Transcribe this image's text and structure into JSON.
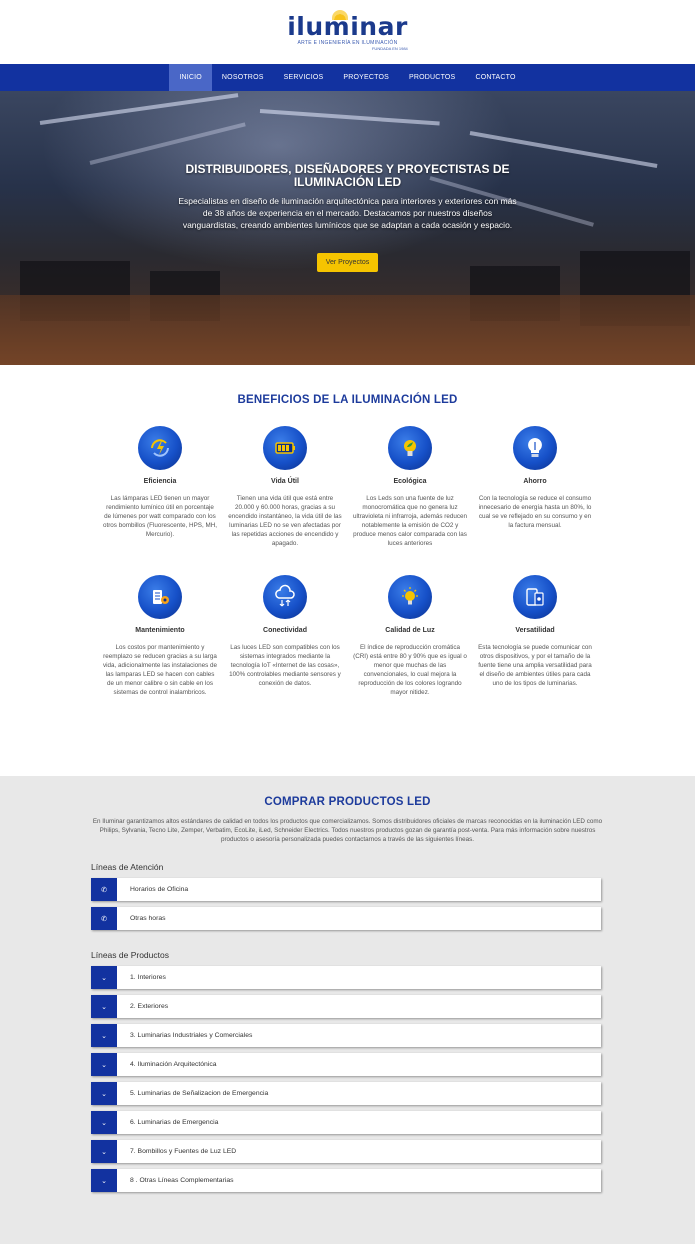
{
  "brand": {
    "logo_text": "iluminar",
    "tagline": "ARTE E INGENIERÍA EN ILUMINACIÓN",
    "founded": "FUNDADA EN 1984"
  },
  "nav": {
    "items": [
      {
        "label": "INICIO"
      },
      {
        "label": "NOSOTROS"
      },
      {
        "label": "SERVICIOS"
      },
      {
        "label": "PROYECTOS"
      },
      {
        "label": "PRODUCTOS"
      },
      {
        "label": "CONTACTO"
      }
    ]
  },
  "hero": {
    "title": "DISTRIBUIDORES, DISEÑADORES Y PROYECTISTAS DE ILUMINACIÓN LED",
    "text": "Especialistas en diseño de iluminación arquitectónica para interiores y exteriores con más de 38 años de experiencia en el mercado. Destacamos por nuestros diseños vanguardistas, creando ambientes lumínicos que se adaptan a cada ocasión y espacio.",
    "button": "Ver Proyectos"
  },
  "benefits": {
    "title": "BENEFICIOS DE LA ILUMINACIÓN LED",
    "items": [
      {
        "icon": "refresh-bolt-icon",
        "title": "Eficiencia",
        "text": "Las lámparas LED tienen un mayor rendimiento lumínico útil en porcentaje de lúmenes por watt comparado con los otros bombillos (Fluorescente, HPS, MH, Mercurio)."
      },
      {
        "icon": "battery-icon",
        "title": "Vida Útil",
        "text": "Tienen una vida útil que está entre 20.000 y 60.000 horas, gracias a su encendido instantáneo, la vida útil de las luminarias LED no se ven afectadas por las repetidas acciones de encendido y apagado."
      },
      {
        "icon": "eco-bulb-icon",
        "title": "Ecológica",
        "text": "Los Leds son una fuente de luz monocromática que no genera luz ultravioleta ni infrarroja, además reducen notablemente la emisión de CO2 y produce menos calor comparada con las luces anteriores"
      },
      {
        "icon": "bulb-icon",
        "title": "Ahorro",
        "text": "Con la tecnología se reduce el consumo innecesario de energía hasta un 80%, lo cual se ve reflejado en su consumo y en la factura mensual."
      },
      {
        "icon": "tools-icon",
        "title": "Mantenimiento",
        "text": "Los costos por mantenimiento y reemplazo se reducen gracias a su larga vida, adicionalmente las instalaciones de las lamparas LED se hacen con cables de un menor calibre o sin cable en los sistemas de control inalambricos."
      },
      {
        "icon": "cloud-icon",
        "title": "Conectividad",
        "text": "Las luces LED son compatibles con los sistemas integrados mediante la tecnología IoT «Internet de las cosas», 100% controlables mediante sensores y conexión de datos."
      },
      {
        "icon": "bright-bulb-icon",
        "title": "Calidad de Luz",
        "text": "El índice de reproducción cromática (CRI) está entre 80 y 90% que es igual o menor que muchas de las convencionales, lo cual mejora la reproducción de los colores logrando mayor nitidez."
      },
      {
        "icon": "devices-icon",
        "title": "Versatilidad",
        "text": "Esta tecnología se puede comunicar con otros dispositivos, y por el tamaño de la fuente tiene una amplia versatilidad para el diseño de ambientes útiles para cada uno de los tipos de luminarias."
      }
    ]
  },
  "products": {
    "title": "COMPRAR PRODUCTOS LED",
    "intro": "En Iluminar garantizamos altos estándares de calidad en todos los productos que comercializamos. Somos distribuidores oficiales de marcas reconocidas en la iluminación LED como Philips, Sylvania, Tecno Lite, Zemper, Verbatim, EcoLite, iLed, Schneider Electrics. Todos nuestros productos gozan de garantía post-venta. Para más información sobre nuestros productos o asesoría personalizada puedes contactarnos a través de las siguientes líneas.",
    "attention_title": "Líneas de Atención",
    "attention": [
      {
        "label": "Horarios de Oficina",
        "icon": "phone-icon"
      },
      {
        "label": "Otras horas",
        "icon": "phone-icon"
      }
    ],
    "lines_title": "Líneas de Productos",
    "lines": [
      {
        "label": "1. Interiores",
        "icon": "chevron-down-icon"
      },
      {
        "label": "2. Exteriores",
        "icon": "chevron-down-icon"
      },
      {
        "label": "3. Luminarias Industriales y Comerciales",
        "icon": "chevron-down-icon"
      },
      {
        "label": "4. Iluminación Arquitectónica",
        "icon": "chevron-down-icon"
      },
      {
        "label": "5. Luminarias de Señalizacion de Emergencia",
        "icon": "chevron-down-icon"
      },
      {
        "label": "6. Luminarias de Emergencia",
        "icon": "chevron-down-icon"
      },
      {
        "label": "7. Bombillos y Fuentes de Luz LED",
        "icon": "chevron-down-icon"
      },
      {
        "label": "8 . Otras Líneas Complementarias",
        "icon": "chevron-down-icon"
      }
    ]
  },
  "colors": {
    "nav_bg": "#1232a0",
    "nav_active": "#4a67c7",
    "accent_yellow": "#f5c400",
    "title_blue": "#1d3b9c",
    "products_bg": "#e8e8e8"
  }
}
